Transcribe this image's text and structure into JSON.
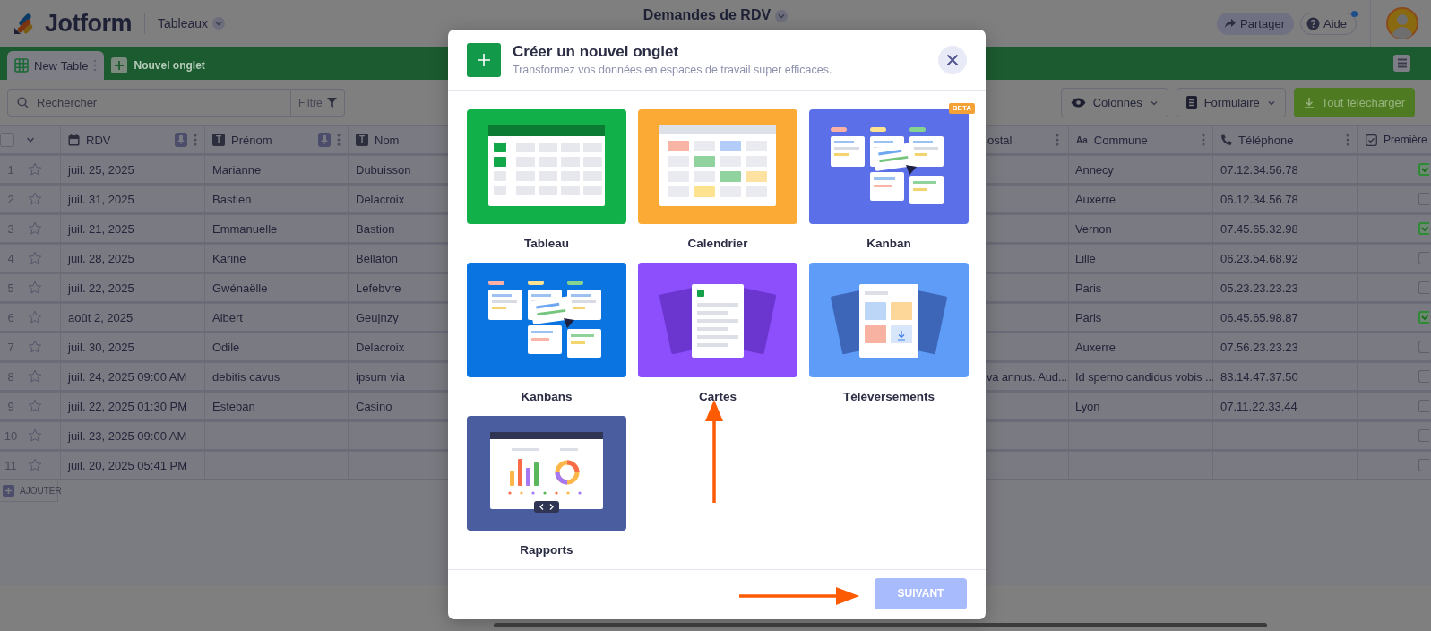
{
  "header": {
    "logo": "Jotform",
    "workspace_menu": "Tableaux",
    "title": "Demandes de RDV",
    "share_button": "Partager",
    "help_button": {
      "label": "Aide",
      "notification": true
    }
  },
  "tabs": [
    {
      "label": "New Table",
      "selected": true
    }
  ],
  "add_tab": "Nouvel onglet",
  "toolbar": {
    "search": {
      "placeholder": "Rechercher"
    },
    "filter": "Filtre",
    "columns_button": "Colonnes",
    "form_button": "Formulaire",
    "download_button": "Tout télécharger"
  },
  "table": {
    "select_all": {
      "checked": false
    },
    "columns": [
      {
        "label": "RDV",
        "kind": "date",
        "pinned": true,
        "menu": true
      },
      {
        "label": "Prénom",
        "kind": "text",
        "icon": "T",
        "pinned": true,
        "menu": true
      },
      {
        "label": "Nom",
        "kind": "text",
        "icon": "T",
        "pinned": false,
        "menu": false
      },
      {
        "label": "ostal",
        "kind": "plain",
        "pinned": false,
        "menu": true
      },
      {
        "label": "Commune",
        "kind": "textarea",
        "icon": "Aa",
        "pinned": false,
        "menu": true
      },
      {
        "label": "Téléphone",
        "kind": "phone",
        "pinned": false,
        "menu": true
      },
      {
        "label": "Première",
        "kind": "checkbox",
        "pinned": false,
        "menu": false
      }
    ],
    "rows": [
      {
        "number": "1",
        "starred": false,
        "rdv": "juil. 25, 2025",
        "prenom": "Marianne",
        "nom": "Dubuisson",
        "commune": "Annecy",
        "telephone": "07.12.34.56.78",
        "premiere_visite": true
      },
      {
        "number": "2",
        "starred": false,
        "rdv": "juil. 31, 2025",
        "prenom": "Bastien",
        "nom": "Delacroix",
        "commune": "Auxerre",
        "telephone": "06.12.34.56.78",
        "premiere_visite": false
      },
      {
        "number": "3",
        "starred": false,
        "rdv": "juil. 21, 2025",
        "prenom": "Emmanuelle",
        "nom": "Bastion",
        "commune": "Vernon",
        "telephone": "07.45.65.32.98",
        "premiere_visite": true
      },
      {
        "number": "4",
        "starred": false,
        "rdv": "juil. 28, 2025",
        "prenom": "Karine",
        "nom": "Bellafon",
        "commune": "Lille",
        "telephone": "06.23.54.68.92",
        "premiere_visite": false
      },
      {
        "number": "5",
        "starred": false,
        "rdv": "juil. 22, 2025",
        "prenom": "Gwénaëlle",
        "nom": "Lefebvre",
        "commune": "Paris",
        "telephone": "05.23.23.23.23",
        "premiere_visite": false
      },
      {
        "number": "6",
        "starred": false,
        "rdv": "août 2, 2025",
        "prenom": "Albert",
        "nom": "Geujnzy",
        "commune": "Paris",
        "telephone": "06.45.65.98.87",
        "premiere_visite": true
      },
      {
        "number": "7",
        "starred": false,
        "rdv": "juil. 30, 2025",
        "prenom": "Odile",
        "nom": "Delacroix",
        "commune": "Auxerre",
        "telephone": "07.56.23.23.23",
        "premiere_visite": false
      },
      {
        "number": "8",
        "starred": false,
        "rdv": "juil. 24, 2025 09:00 AM",
        "prenom": "debitis cavus",
        "nom": "ipsum via",
        "postal": "va annus. Aud...",
        "commune": "Id sperno candidus vobis ...",
        "telephone": "83.14.47.37.50",
        "premiere_visite": false
      },
      {
        "number": "9",
        "starred": false,
        "rdv": "juil. 22, 2025 01:30 PM",
        "prenom": "Esteban",
        "nom": "Casino",
        "commune": "Lyon",
        "telephone": "07.11.22.33.44",
        "premiere_visite": false
      },
      {
        "number": "10",
        "starred": false,
        "rdv": "juil. 23, 2025 09:00 AM",
        "premiere_visite": false
      },
      {
        "number": "11",
        "starred": false,
        "rdv": "juil. 20, 2025 05:41 PM",
        "premiere_visite": false
      }
    ],
    "add_row": "AJOUTER"
  },
  "modal": {
    "title": "Créer un nouvel onglet",
    "subtitle": "Transformez vos données en espaces de travail super efficaces.",
    "options": [
      {
        "label": "Tableau",
        "kind": "table",
        "color": "#12b049",
        "selected": false
      },
      {
        "label": "Calendrier",
        "kind": "calendar",
        "color": "#fbaa36",
        "selected": false
      },
      {
        "label": "Kanban",
        "kind": "kanban",
        "color": "#5a6fe8",
        "badge": "BETA",
        "selected": false
      },
      {
        "label": "Kanbans",
        "kind": "kanban",
        "color": "#0a75e0",
        "selected": false
      },
      {
        "label": "Cartes",
        "kind": "cards",
        "color": "#8c4ffb",
        "selected": false
      },
      {
        "label": "Téléversements",
        "kind": "uploads",
        "color": "#5f9cf8",
        "selected": false
      },
      {
        "label": "Rapports",
        "kind": "reports",
        "color": "#4a5e9f",
        "selected": false
      }
    ],
    "next_button": {
      "label": "SUIVANT",
      "disabled": true
    }
  }
}
